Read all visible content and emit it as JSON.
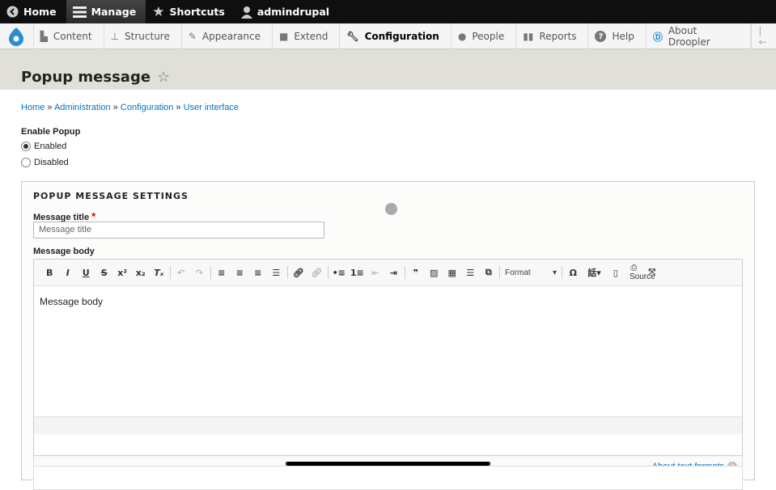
{
  "toolbar": {
    "items": [
      {
        "label": "Home",
        "icon": "chevron-left-circle-icon"
      },
      {
        "label": "Manage",
        "icon": "menu-icon"
      },
      {
        "label": "Shortcuts",
        "icon": "star-icon"
      },
      {
        "label": "admindrupal",
        "icon": "user-icon"
      }
    ]
  },
  "tray": {
    "items": [
      {
        "label": "Content",
        "icon": "file-icon"
      },
      {
        "label": "Structure",
        "icon": "sitemap-icon"
      },
      {
        "label": "Appearance",
        "icon": "paintbrush-icon"
      },
      {
        "label": "Extend",
        "icon": "puzzle-icon"
      },
      {
        "label": "Configuration",
        "icon": "wrench-icon",
        "active": true
      },
      {
        "label": "People",
        "icon": "people-icon"
      },
      {
        "label": "Reports",
        "icon": "bar-chart-icon"
      },
      {
        "label": "Help",
        "icon": "help-icon"
      },
      {
        "label": "About Droopler",
        "icon": "droopler-icon"
      }
    ]
  },
  "page": {
    "title": "Popup message"
  },
  "breadcrumb": [
    "Home",
    "Administration",
    "Configuration",
    "User interface"
  ],
  "enable_popup": {
    "label": "Enable Popup",
    "options": [
      "Enabled",
      "Disabled"
    ],
    "selected": "Enabled"
  },
  "settings": {
    "legend": "POPUP MESSAGE SETTINGS",
    "title_label": "Message title",
    "title_placeholder": "Message title",
    "body_label": "Message body",
    "body_value": "Message body",
    "format": "Format",
    "source": "Source",
    "about": "About text formats"
  },
  "colors": {
    "link": "#0074bd",
    "required": "#e00",
    "toolbar_bg": "#0f0f0f"
  }
}
